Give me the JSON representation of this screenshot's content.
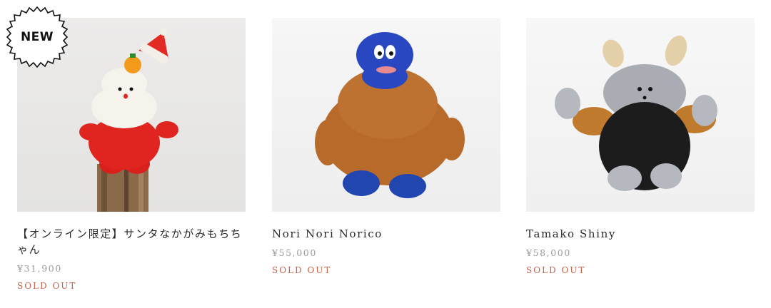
{
  "badge": {
    "label": "NEW",
    "icon": "new-badge-icon"
  },
  "products": [
    {
      "name": "【オンライン限定】サンタなかがみもちちゃん",
      "price": "¥31,900",
      "status": "SOLD OUT",
      "image": "santa-kagami-mochi-plush-image"
    },
    {
      "name": "Nori Nori Norico",
      "price": "¥55,000",
      "status": "SOLD OUT",
      "image": "brown-blue-fuzzy-monster-plush-image"
    },
    {
      "name": "Tamako Shiny",
      "price": "¥58,000",
      "status": "SOLD OUT",
      "image": "gray-horned-monster-plush-image"
    }
  ],
  "colors": {
    "sold_out": "#c4624a",
    "price": "#9a9a9a",
    "name": "#2a2a2a"
  }
}
